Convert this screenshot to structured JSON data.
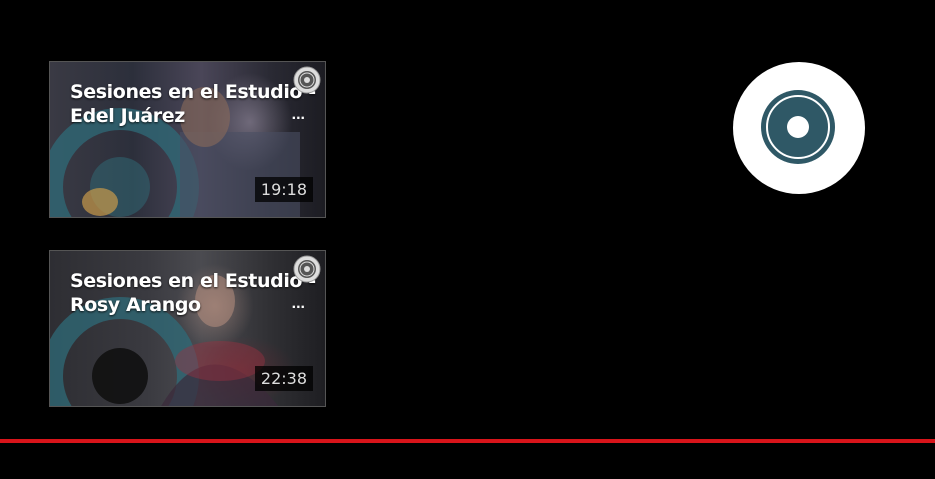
{
  "videos": [
    {
      "title_line1": "Sesiones en el Estudio -",
      "title_line2": "Edel Juárez",
      "ellipsis": "...",
      "duration": "19:18",
      "channel_icon": "disc-icon"
    },
    {
      "title_line1": "Sesiones en el Estudio -",
      "title_line2": "Rosy Arango",
      "ellipsis": "...",
      "duration": "22:38",
      "channel_icon": "disc-icon"
    }
  ],
  "branding": {
    "logo_icon": "disc-logo-icon",
    "logo_color": "#2f5866",
    "logo_bg": "#ffffff"
  },
  "player": {
    "progress_color": "#d7141a",
    "progress_fraction": 1.0
  }
}
